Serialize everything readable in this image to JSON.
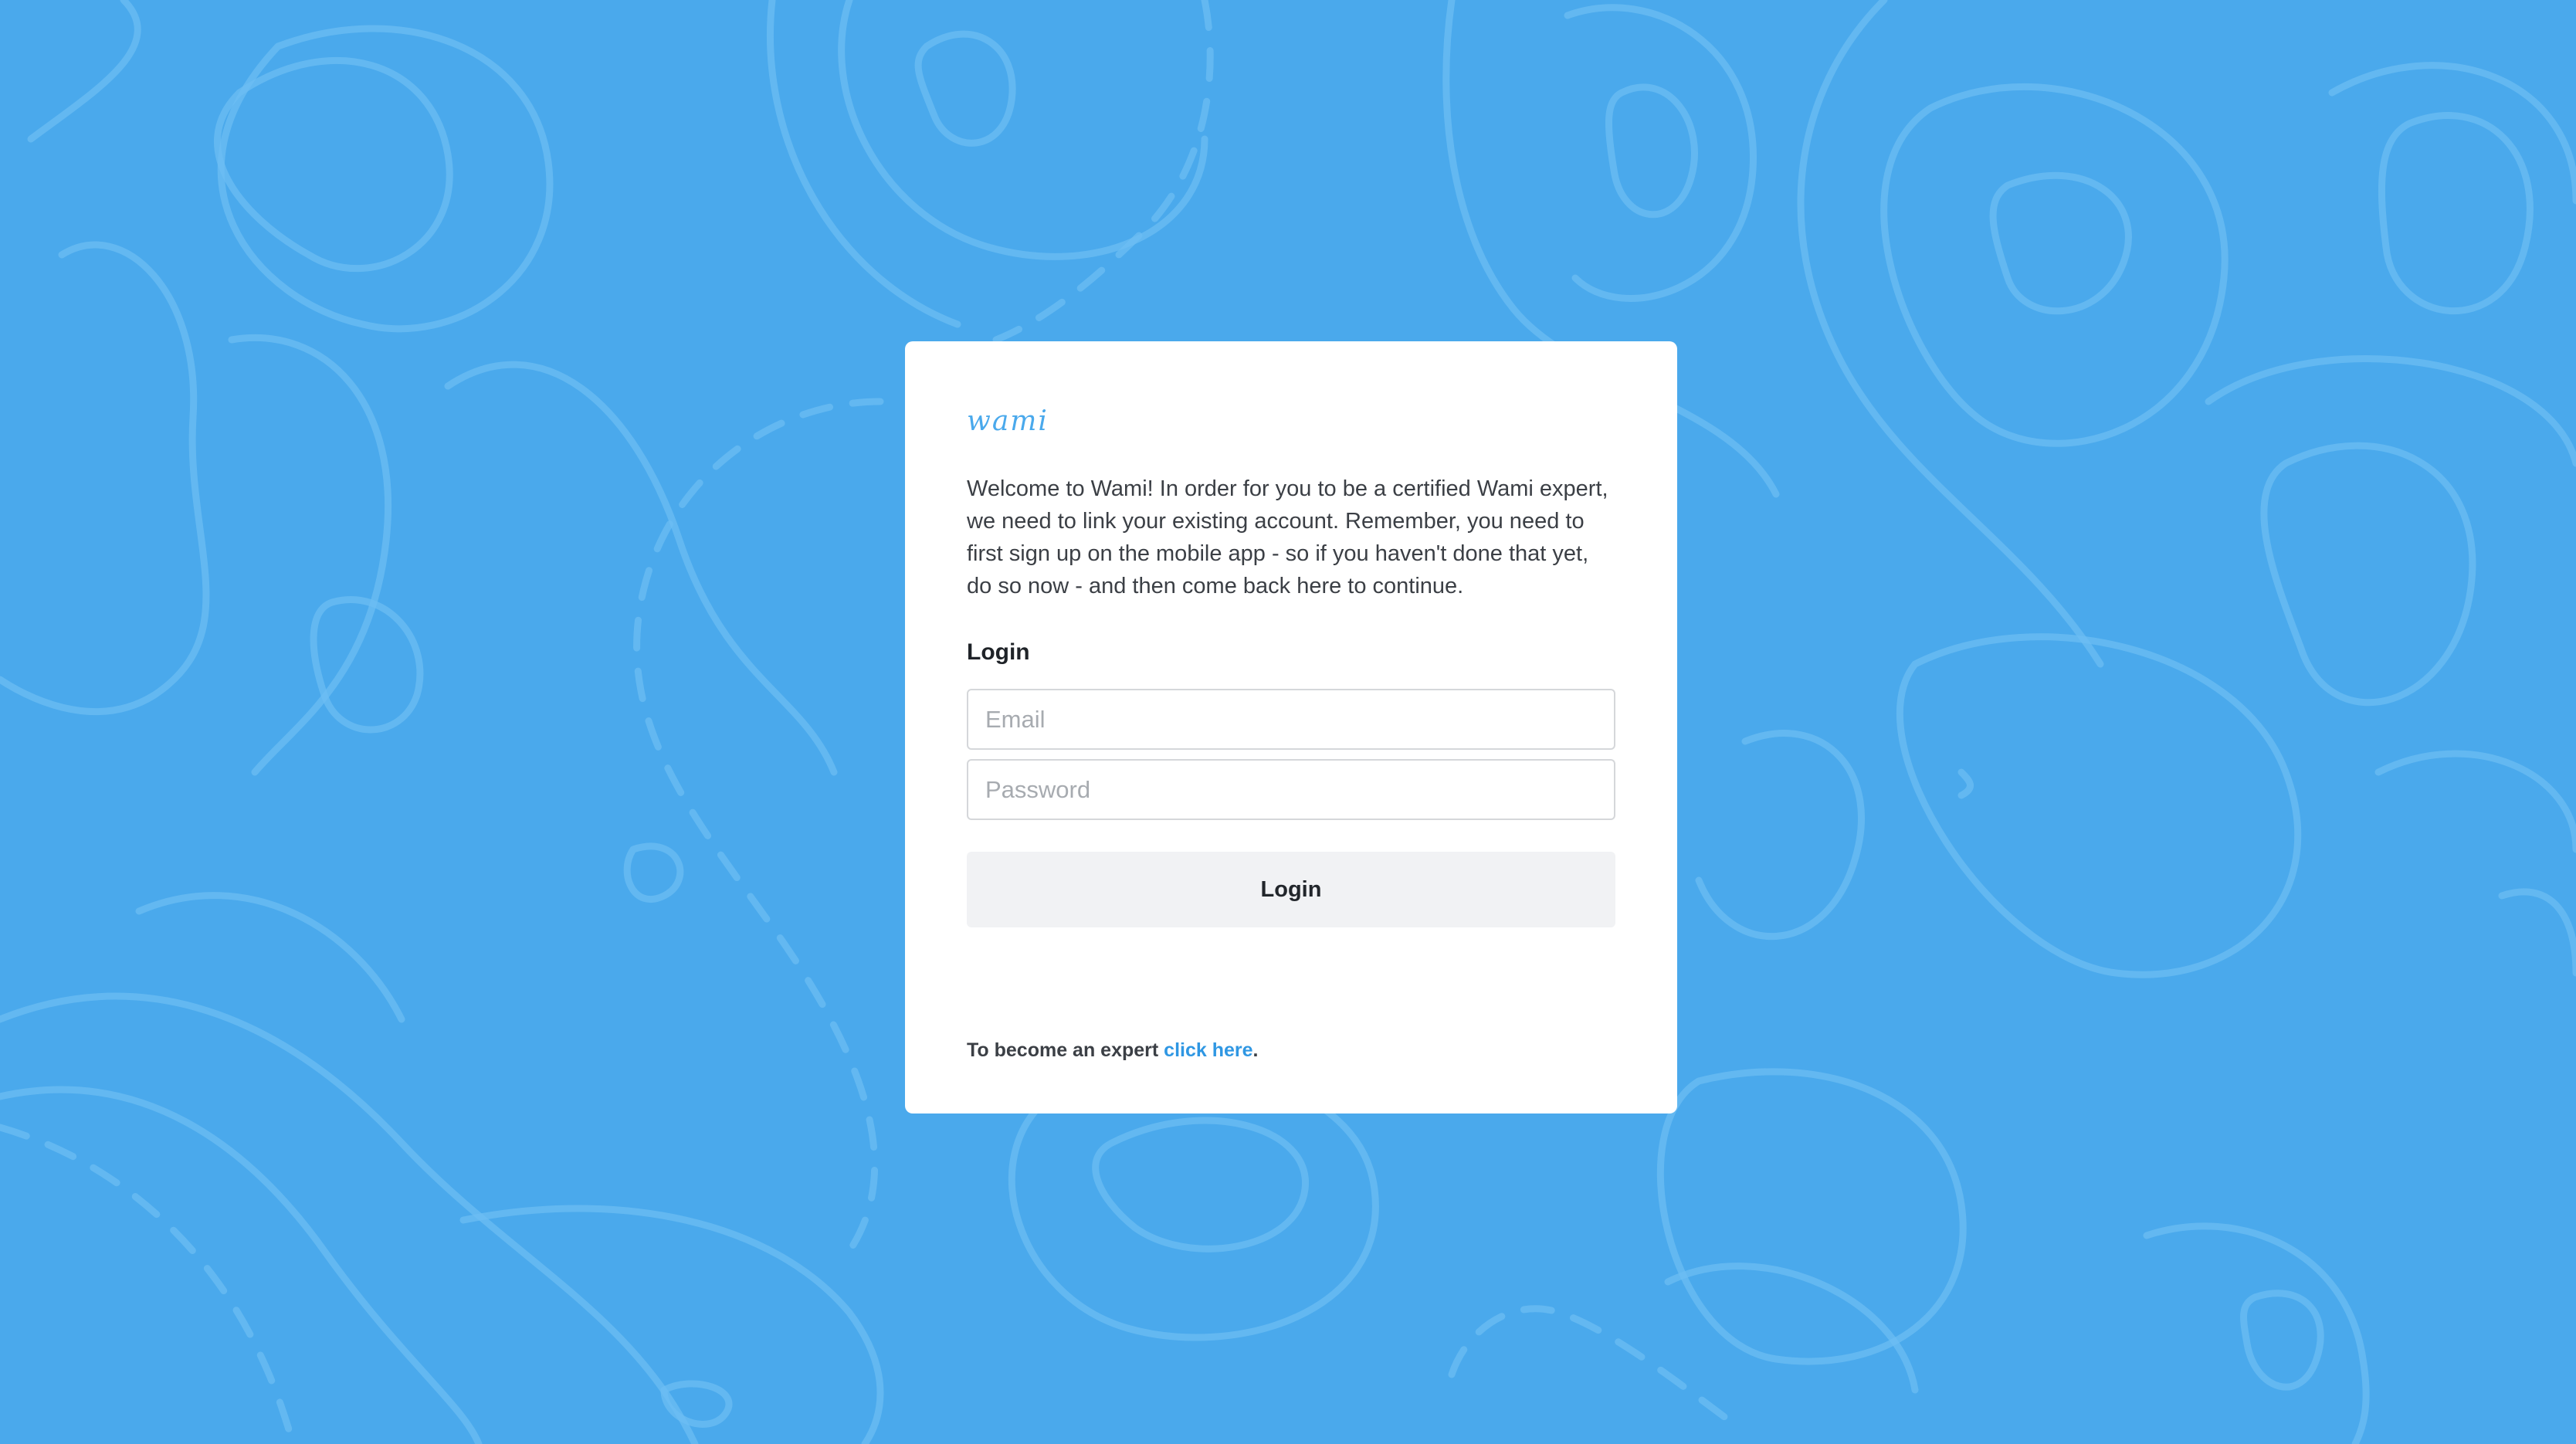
{
  "card": {
    "logo": "wami",
    "intro": "Welcome to Wami! In order for you to be a certified Wami expert, we need to link your existing account. Remember, you need to first sign up on the mobile app - so if you haven't done that yet, do so now - and then come back here to continue.",
    "login_heading": "Login",
    "email_placeholder": "Email",
    "password_placeholder": "Password",
    "login_button": "Login",
    "footer_text": "To become an expert ",
    "footer_link": "click here",
    "footer_suffix": "."
  },
  "colors": {
    "background": "#4aa9ec",
    "accent": "#2f97e3"
  }
}
